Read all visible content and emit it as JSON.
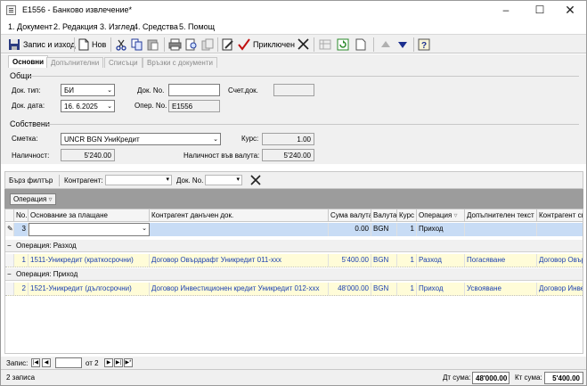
{
  "window": {
    "title": "E1556 - Банково извлечение*"
  },
  "menu": [
    "1. Документ",
    "2. Редакция",
    "3. Изглед",
    "4. Средства",
    "5. Помощ"
  ],
  "toolbar": {
    "save_label": "Запис и изход",
    "new_label": "Нов",
    "post_label": "Приключен"
  },
  "tabs": [
    "Основни",
    "Допълнителни",
    "Списъци",
    "Връзки с документи"
  ],
  "general": {
    "group_label": "Общи",
    "doc_type_label": "Док. тип:",
    "doc_type_value": "БИ",
    "doc_no_label": "Док. No.",
    "doc_no_value": "",
    "acc_doc_label": "Счет.док.",
    "acc_doc_value": "",
    "doc_date_label": "Док. дата:",
    "doc_date_value": "16. 6.2025",
    "oper_no_label": "Опер. No.",
    "oper_no_value": "E1556"
  },
  "own": {
    "group_label": "Собствени",
    "account_label": "Сметка:",
    "account_value": "UNCR BGN УниКредит",
    "rate_label": "Курс:",
    "rate_value": "1.00",
    "availability_label": "Наличност:",
    "availability_value": "5'240.00",
    "availability_cur_label": "Наличност във валута:",
    "availability_cur_value": "5'240.00"
  },
  "filter": {
    "quick_label": "Бърз филтър",
    "partner_label": "Контрагент:",
    "docno_label": "Док. No."
  },
  "grouping": {
    "chip": "Операция"
  },
  "grid": {
    "headers": [
      "No.",
      "Основание за плащане",
      "Контрагент данъчен док.",
      "Сума валута",
      "Валута",
      "Курс",
      "Операция",
      "Допълнителен текст",
      "Контрагент св"
    ],
    "edit_row": {
      "no": "3",
      "amount": "0.00",
      "currency": "BGN",
      "rate": "1",
      "operation": "Приход"
    },
    "groups": [
      {
        "title": "Операция: Разход",
        "rows": [
          {
            "no": "1",
            "basis": "1511-Уникредит (краткосрочни)",
            "partner_doc": "Договор Овърдрафт Уникредит 011-xxx",
            "amount": "5'400.00",
            "currency": "BGN",
            "rate": "1",
            "operation": "Разход",
            "extra": "Погасяване",
            "partner": "Договор Овър"
          }
        ]
      },
      {
        "title": "Операция: Приход",
        "rows": [
          {
            "no": "2",
            "basis": "1521-Уникредит (дългосрочни)",
            "partner_doc": "Договор Инвестиционен кредит Уникредит 012-xxx",
            "amount": "48'000.00",
            "currency": "BGN",
            "rate": "1",
            "operation": "Приход",
            "extra": "Усвояване",
            "partner": "Договор Инве"
          }
        ]
      }
    ]
  },
  "nav": {
    "record_label": "Запис:",
    "of_label": "от 2"
  },
  "status": {
    "count": "2 записа",
    "debit_label": "Дт сума:",
    "debit_value": "48'000.00",
    "credit_label": "Кт сума:",
    "credit_value": "5'400.00"
  }
}
